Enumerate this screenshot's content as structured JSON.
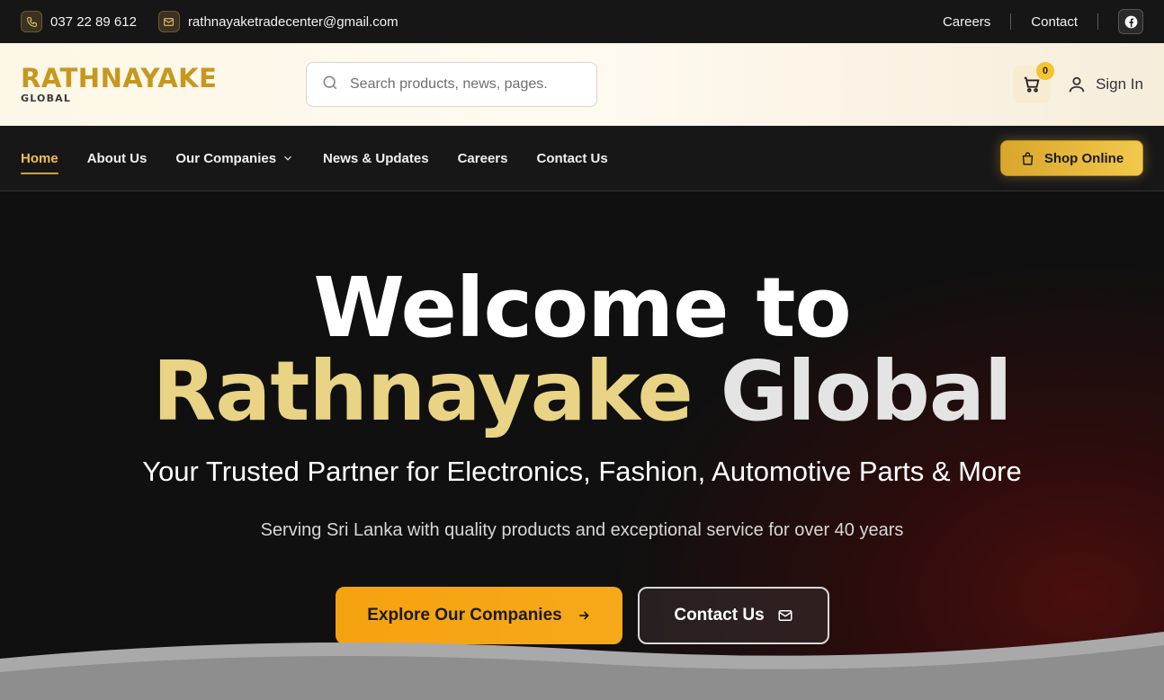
{
  "topbar": {
    "phone": "037 22 89 612",
    "email": "rathnayaketradecenter@gmail.com",
    "links": [
      "Careers",
      "Contact"
    ],
    "social_icon": "facebook-icon"
  },
  "header": {
    "logo_main": "RATHNAYAKE",
    "logo_sub": "GLOBAL",
    "search_placeholder": "Search products, news, pages.",
    "cart_count": "0",
    "signin_label": "Sign In"
  },
  "nav": {
    "items": [
      {
        "label": "Home",
        "active": true
      },
      {
        "label": "About Us"
      },
      {
        "label": "Our Companies",
        "dropdown": true
      },
      {
        "label": "News & Updates"
      },
      {
        "label": "Careers"
      },
      {
        "label": "Contact Us"
      }
    ],
    "shop_label": "Shop Online"
  },
  "hero": {
    "title_line1": "Welcome to",
    "title_line2_gold": "Rathnayake",
    "title_line2_silver": "Global",
    "subtitle": "Your Trusted Partner for Electronics, Fashion, Automotive Parts & More",
    "description": "Serving Sri Lanka with quality products and exceptional service for over 40 years",
    "primary_button": "Explore Our Companies",
    "secondary_button": "Contact Us"
  },
  "colors": {
    "brand_gold": "#c7971e",
    "accent_yellow": "#f2c14e",
    "primary_orange": "#f5a20f",
    "dark": "#161616"
  }
}
